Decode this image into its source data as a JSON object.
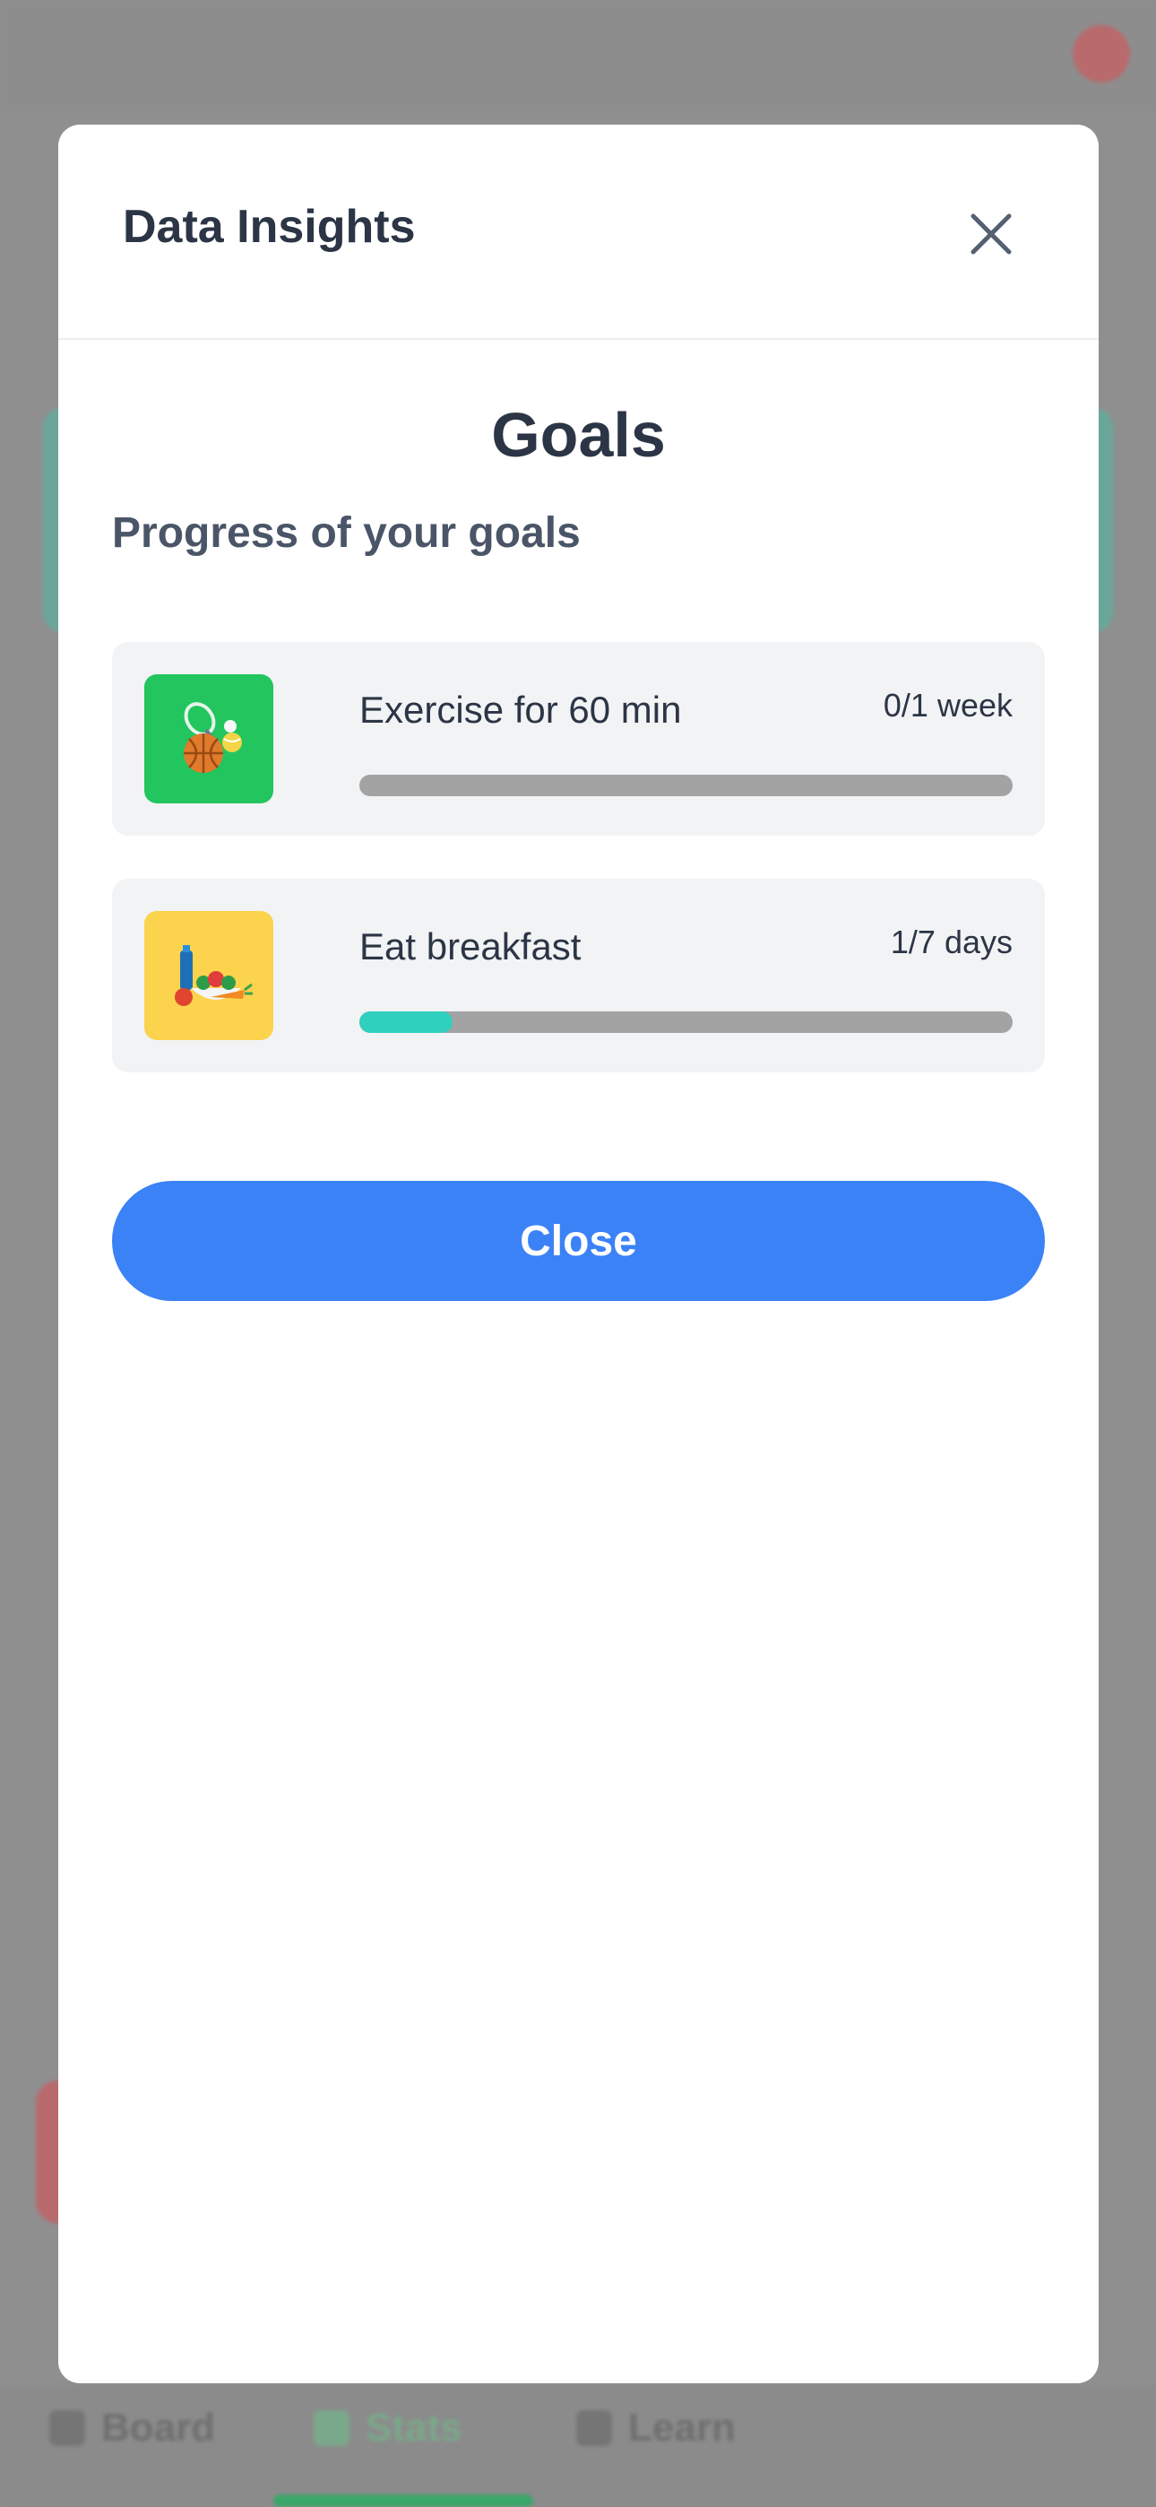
{
  "modal": {
    "title": "Data Insights",
    "close_icon": "close-icon"
  },
  "goals_section": {
    "title": "Goals",
    "subtitle": "Progress of your goals",
    "items": [
      {
        "name": "Exercise for 60 min",
        "count": "0/1 week",
        "progress": 0,
        "icon": "sports-equipment-icon",
        "icon_bg": "#22c55e"
      },
      {
        "name": "Eat breakfast",
        "count": "1/7 days",
        "progress": 0.142857,
        "icon": "breakfast-food-icon",
        "icon_bg": "#fcd34d"
      }
    ]
  },
  "actions": {
    "close_label": "Close"
  },
  "background_nav": {
    "tabs": [
      "Board",
      "Stats",
      "Learn"
    ]
  },
  "colors": {
    "accent": "#3b82f6",
    "progress_fill": "#2fd0bd",
    "progress_track": "#a3a3a3",
    "text_dark": "#2b3545"
  }
}
